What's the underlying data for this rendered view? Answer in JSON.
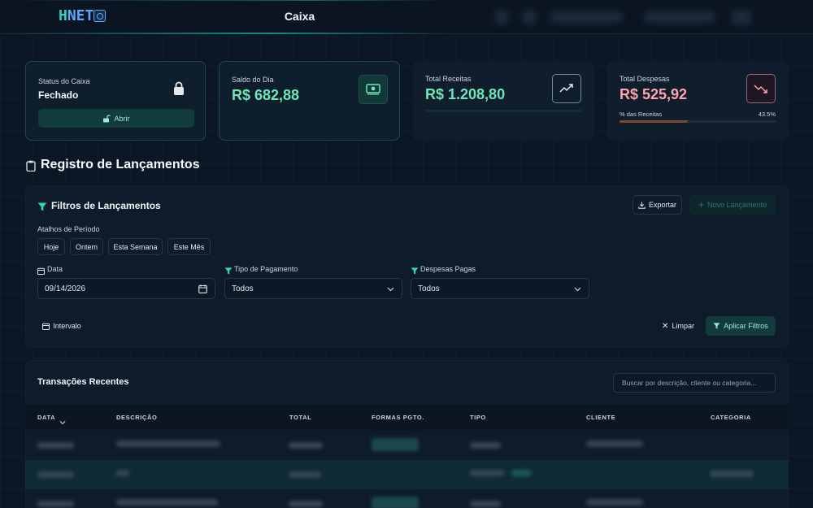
{
  "header": {
    "logo_h": "H",
    "logo_rest": "NET",
    "title": "Caixa"
  },
  "cards": {
    "status": {
      "label": "Status do Caixa",
      "value": "Fechado",
      "button_label": "Abrir"
    },
    "saldo": {
      "label": "Saldo do Dia",
      "value": "R$ 682,88"
    },
    "receitas": {
      "label": "Total Receitas",
      "value": "R$ 1.208,80"
    },
    "despesas": {
      "label": "Total Despesas",
      "value": "R$ 525,92",
      "pct_label": "% das Receitas",
      "pct_value": "43.5%",
      "pct_fraction": 0.435
    }
  },
  "section": {
    "title": "Registro de Lançamentos"
  },
  "filters": {
    "title": "Filtros de Lançamentos",
    "export_label": "Exportar",
    "new_label": "Novo Lançamento",
    "shortcuts_label": "Atalhos de Período",
    "shortcuts": [
      "Hoje",
      "Ontem",
      "Esta Semana",
      "Este Mês"
    ],
    "date_label": "Data",
    "date_value": "09/14/2026",
    "payment_label": "Tipo de Pagamento",
    "payment_value": "Todos",
    "paid_label": "Despesas Pagas",
    "paid_value": "Todos",
    "interval_label": "Intervalo",
    "clear_label": "Limpar",
    "apply_label": "Aplicar Filtros"
  },
  "transactions": {
    "title": "Transações Recentes",
    "search_placeholder": "Buscar por descrição, cliente ou categoria...",
    "columns": [
      "DATA",
      "DESCRIÇÃO",
      "TOTAL",
      "FORMAS PGTO.",
      "TIPO",
      "CLIENTE",
      "CATEGORIA"
    ]
  },
  "colors": {
    "accent": "#14b8a6",
    "receita": "#6ee7b7",
    "despesa": "#fda4af",
    "bg": "#0c1726"
  }
}
